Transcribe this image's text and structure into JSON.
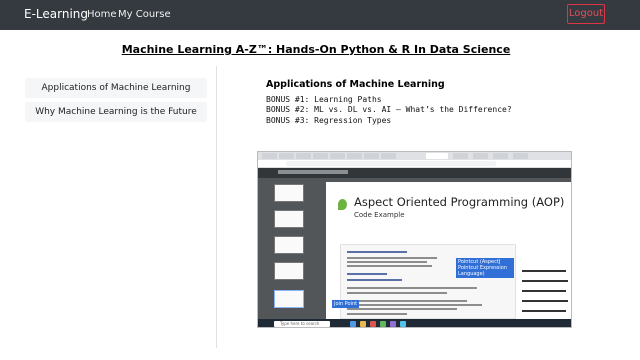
{
  "navbar": {
    "brand": "E-Learning",
    "links": [
      "Home",
      "My Course"
    ],
    "logout": "Logout"
  },
  "course": {
    "title": "Machine Learning A-Z™: Hands-On Python & R In Data Science"
  },
  "sidebar": {
    "items": [
      {
        "label": "Applications of Machine Learning"
      },
      {
        "label": "Why Machine Learning is the Future"
      }
    ]
  },
  "main": {
    "section_title": "Applications of Machine Learning",
    "bonuses": [
      "BONUS #1: Learning Paths",
      "BONUS #2: ML vs. DL vs. AI – What’s the Difference?",
      "BONUS #3: Regression Types"
    ],
    "screenshot": {
      "slide_title": "Aspect Oriented Programming (AOP)",
      "slide_subtitle": "Code Example",
      "callout_pointcut": "Pointcut (AspectJ Pointcut Expression Language)",
      "callout_joinpoint": "Join Point",
      "taskbar_search": "Type here to search"
    }
  },
  "colors": {
    "navbar_bg": "#343a40",
    "logout_border": "#dc3545",
    "sidebar_item_bg": "#f4f6f7"
  }
}
